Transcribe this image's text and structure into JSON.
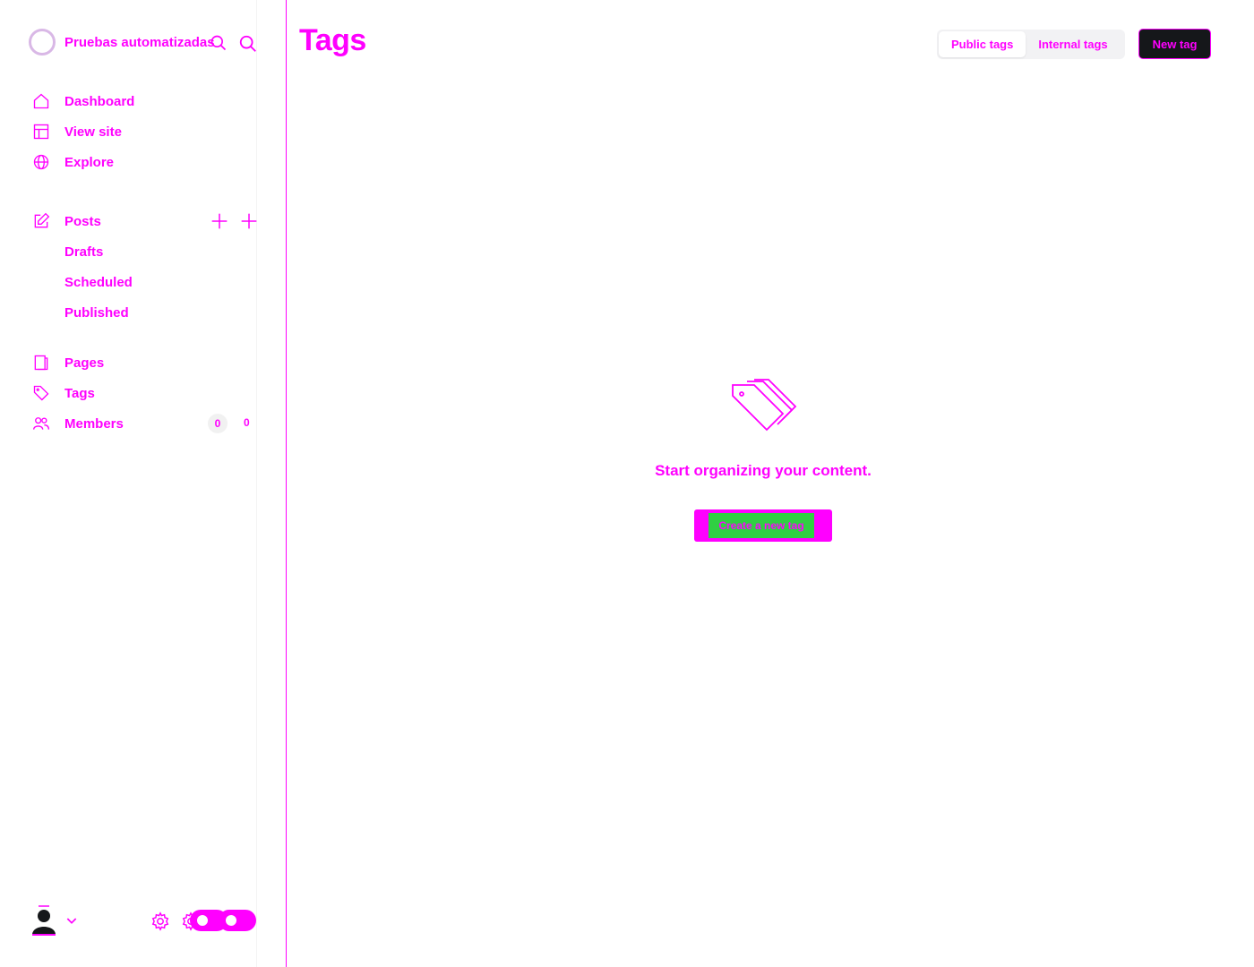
{
  "sidebar": {
    "site_name": "Pruebas automatizadas",
    "nav": [
      {
        "label": "Dashboard",
        "icon": "home-icon"
      },
      {
        "label": "View site",
        "icon": "layout-icon"
      },
      {
        "label": "Explore",
        "icon": "globe-icon"
      }
    ],
    "posts": {
      "label": "Posts",
      "icon": "edit-icon",
      "sub": [
        "Drafts",
        "Scheduled",
        "Published"
      ]
    },
    "pages": {
      "label": "Pages",
      "icon": "page-icon"
    },
    "tags": {
      "label": "Tags",
      "icon": "tag-icon"
    },
    "members": {
      "label": "Members",
      "icon": "members-icon",
      "badge": "0",
      "count": "0"
    }
  },
  "header": {
    "title": "Tags",
    "tabs": [
      "Public tags",
      "Internal tags"
    ],
    "active_tab": "Public tags",
    "new_button": "New tag"
  },
  "empty_state": {
    "icon": "tags-icon",
    "message": "Start organizing your content.",
    "cta": "Create a new tag"
  },
  "colors": {
    "accent": "#ff00ff",
    "cta_green": "#30cf43",
    "dark_button": "#15171a"
  }
}
